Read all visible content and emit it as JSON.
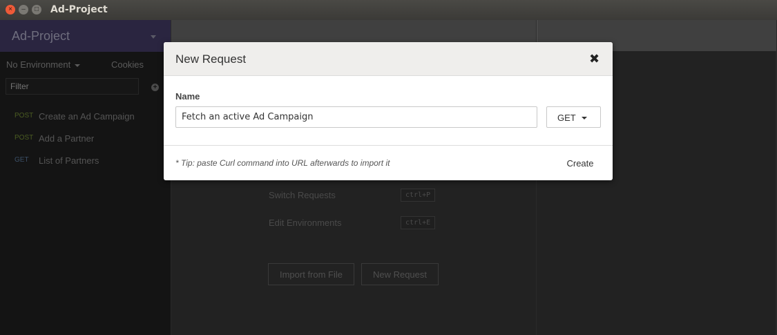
{
  "window": {
    "title": "Ad-Project",
    "close_glyph": "×",
    "min_glyph": "–",
    "max_glyph": "□"
  },
  "sidebar": {
    "workspace": "Ad-Project",
    "environment": "No Environment",
    "cookies": "Cookies",
    "filter_placeholder": "Filter",
    "add_glyph": "+",
    "requests": [
      {
        "method": "POST",
        "name": "Create an Ad Campaign"
      },
      {
        "method": "POST",
        "name": "Add a Partner"
      },
      {
        "method": "GET",
        "name": "List of Partners"
      }
    ]
  },
  "main": {
    "shortcuts": [
      {
        "label": "Switch Requests",
        "key": "ctrl+P"
      },
      {
        "label": "Edit Environments",
        "key": "ctrl+E"
      }
    ],
    "import_button": "Import from File",
    "new_request_button": "New Request"
  },
  "modal": {
    "title": "New Request",
    "close_glyph": "✖",
    "name_label": "Name",
    "name_value": "Fetch an active Ad Campaign",
    "method": "GET",
    "tip": "* Tip: paste Curl command into URL afterwards to import it",
    "create_label": "Create"
  },
  "colors": {
    "accent_workspace": "#2a2540",
    "post": "#4b5d22",
    "get": "#3b4f66"
  }
}
